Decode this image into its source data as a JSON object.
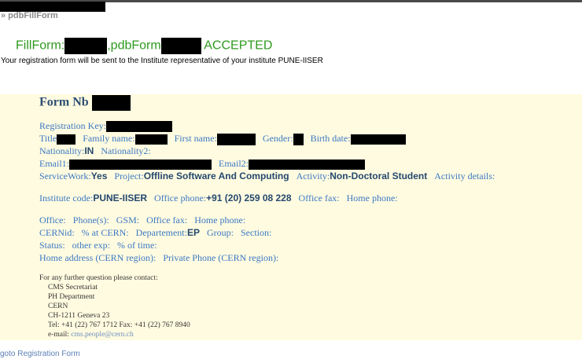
{
  "header": {
    "breadcrumb": "» pdbFillForm"
  },
  "banner": {
    "prefix": "FillForm:",
    "middle": ",pdbForm",
    "status": "ACCEPTED"
  },
  "notice": "Your registration form will be sent to the Institute representative of your institute PUNE-IISER",
  "form": {
    "title": "Form Nb",
    "labels": {
      "reg_key": "Registration Key:",
      "title": "Title",
      "family_name": "Family name:",
      "first_name": "First name:",
      "gender": "Gender:",
      "birth_date": "Birth date:",
      "nationality": "Nationality:",
      "nationality2": "Nationality2:",
      "email1": "Email1:",
      "email2": "Email2:",
      "service_work": "ServiceWork:",
      "project": "Project:",
      "activity": "Activity:",
      "activity_details": "Activity details:",
      "institute_code": "Institute code:",
      "office_phone": "Office phone:",
      "office_fax": "Office fax:",
      "home_phone": "Home phone:",
      "office": "Office:",
      "phones": "Phone(s):",
      "gsm": "GSM:",
      "office_fax2": "Office fax:",
      "home_phone2": "Home phone:",
      "cernid": "CERNid:",
      "pct_cern": "% at CERN:",
      "department": "Departement:",
      "group": "Group:",
      "section": "Section:",
      "status": "Status:",
      "other_exp": "other exp:",
      "pct_time": "% of time:",
      "home_address": "Home address (CERN region):",
      "private_phone": "Private Phone (CERN region):"
    },
    "values": {
      "nationality": "IN",
      "service_work": "Yes",
      "project": "Offline Software And Computing",
      "activity": "Non-Doctoral Student",
      "institute_code": "PUNE-IISER",
      "office_phone": "+91 (20) 259 08 228",
      "department": "EP"
    }
  },
  "contact": {
    "intro": "For any further question please contact:",
    "lines": [
      "CMS Secretariat",
      "PH Department",
      "CERN",
      "CH-1211 Geneva 23",
      "Tel: +41 (22) 767 1712 Fax: +41 (22) 767 8940"
    ],
    "email_label": "e-mail:",
    "email": "cms.people@cern.ch"
  },
  "footer": {
    "link": "goto Registration Form"
  }
}
